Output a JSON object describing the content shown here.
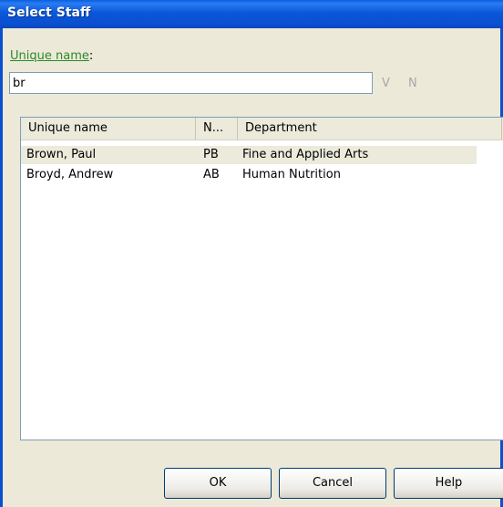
{
  "window": {
    "title": "Select Staff"
  },
  "search": {
    "label": "Unique name",
    "label_suffix": ":",
    "value": "br",
    "v_button": "V",
    "n_button": "N"
  },
  "list": {
    "columns": [
      "Unique name",
      "N...",
      "Department"
    ],
    "rows": [
      {
        "name": "Brown, Paul",
        "initials": "PB",
        "department": "Fine and Applied Arts",
        "selected": true
      },
      {
        "name": "Broyd, Andrew",
        "initials": "AB",
        "department": "Human Nutrition",
        "selected": false
      }
    ]
  },
  "buttons": {
    "ok": "OK",
    "cancel": "Cancel",
    "help": "Help"
  },
  "colors": {
    "title_bar": "#0a57d9",
    "label_green": "#2b8a2b",
    "dialog_bg": "#ece9d8",
    "selection": "#ebeadb"
  }
}
